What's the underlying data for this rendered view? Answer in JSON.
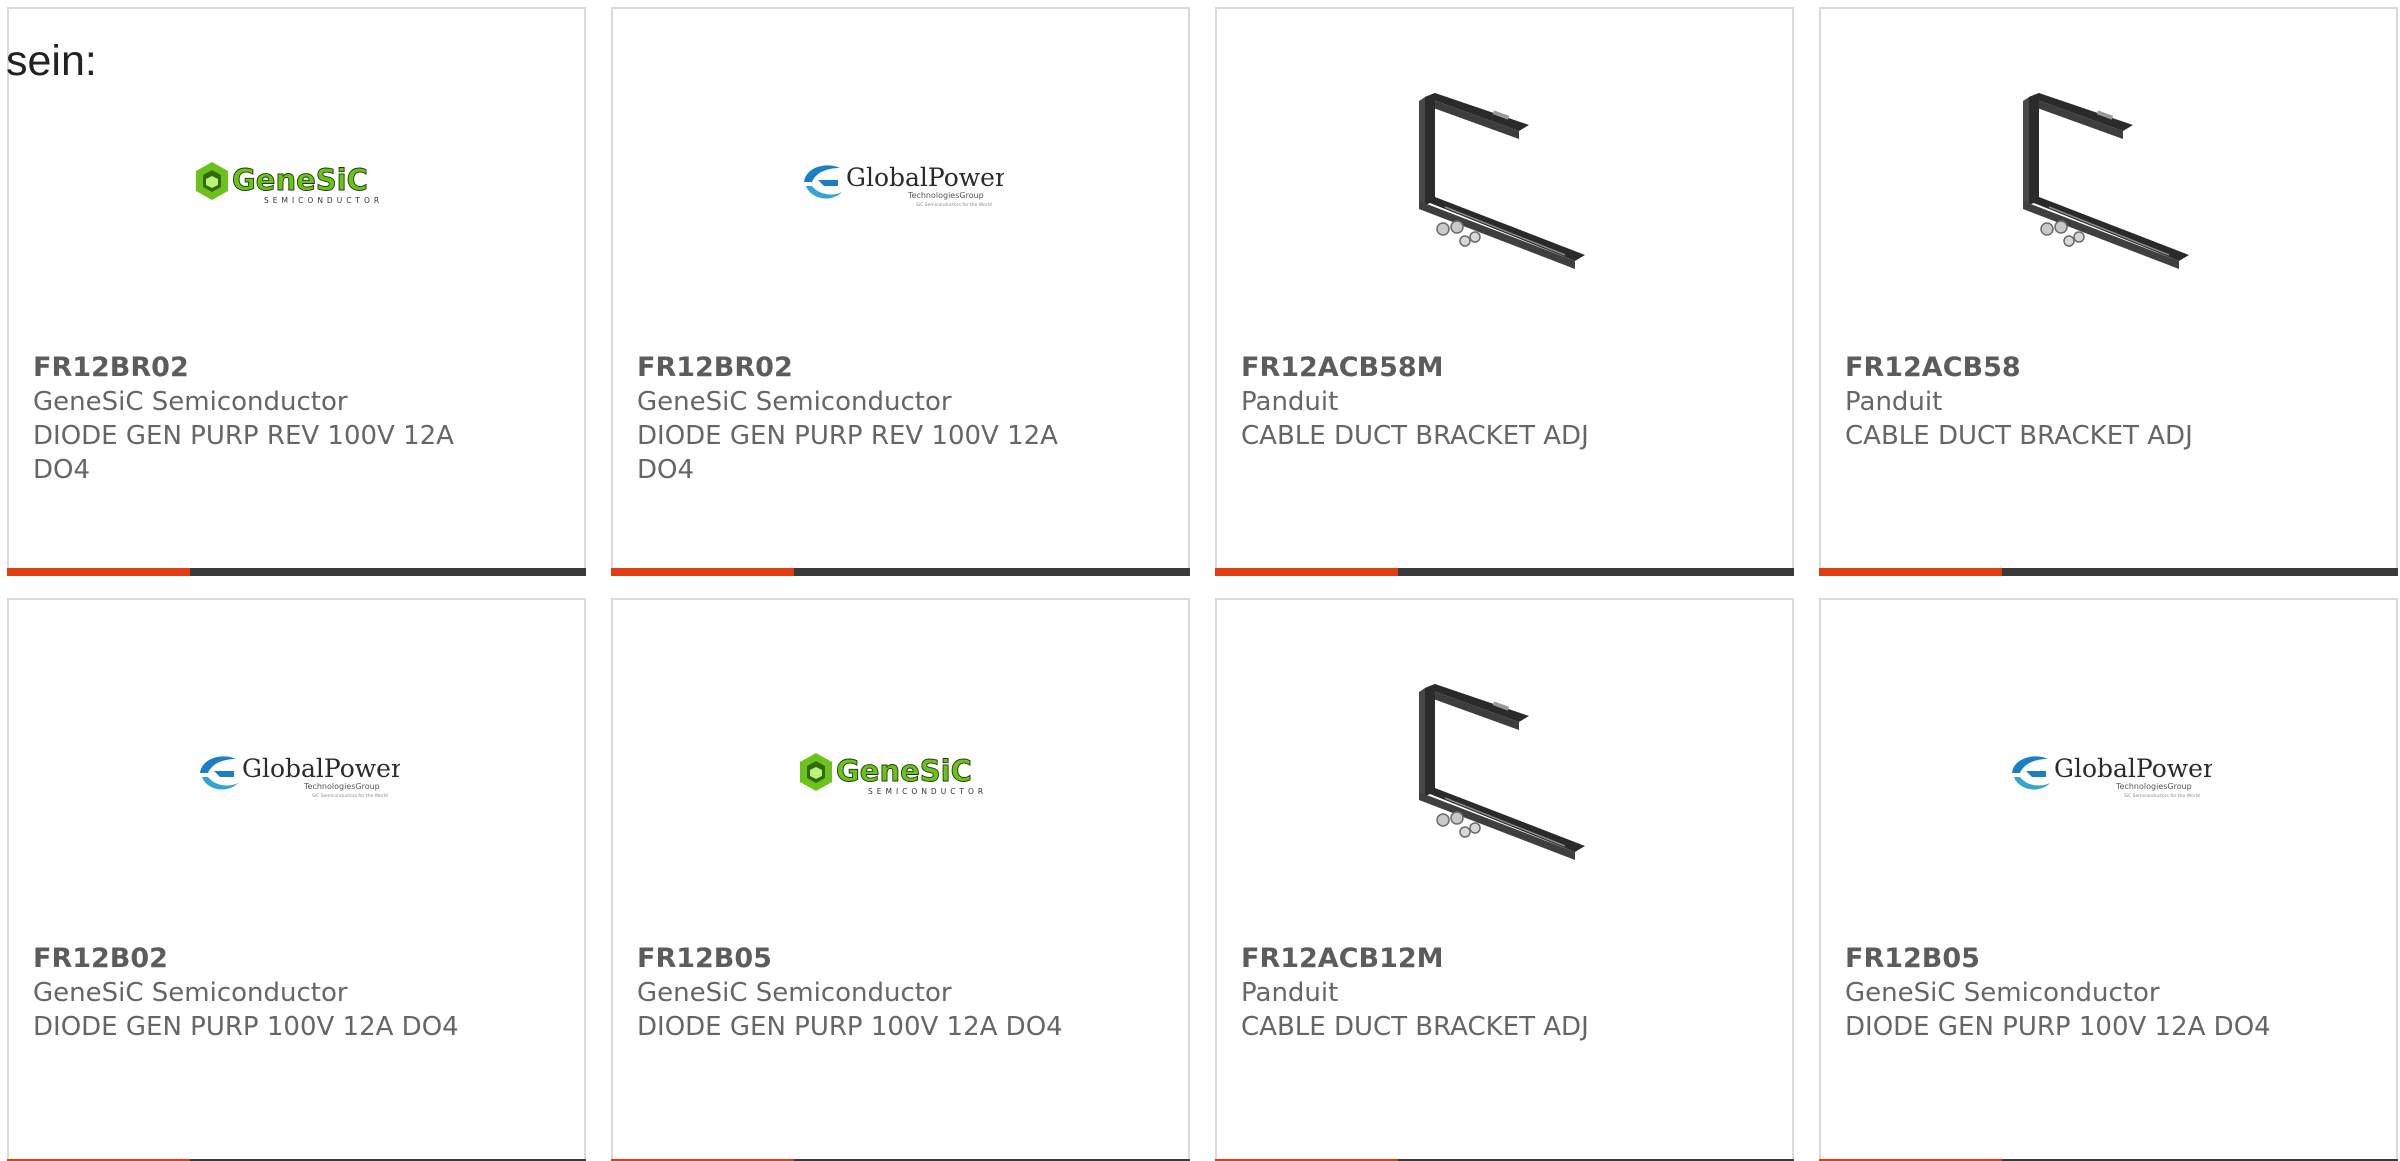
{
  "intro_text": "sein:",
  "colors": {
    "accent": "#e03c12",
    "bar": "#3a3a3a",
    "border": "#dadada",
    "genesic_green": "#6cc21c",
    "globalpower_blue": "#1a7fc4"
  },
  "products": [
    {
      "part_number": "FR12BR02",
      "manufacturer": "GeneSiC Semiconductor",
      "description": "DIODE GEN PURP REV 100V 12A DO4",
      "image": "genesic-logo"
    },
    {
      "part_number": "FR12BR02",
      "manufacturer": "GeneSiC Semiconductor",
      "description": "DIODE GEN PURP REV 100V 12A DO4",
      "image": "globalpower-logo"
    },
    {
      "part_number": "FR12ACB58M",
      "manufacturer": "Panduit",
      "description": "CABLE DUCT BRACKET ADJ",
      "image": "bracket-photo"
    },
    {
      "part_number": "FR12ACB58",
      "manufacturer": "Panduit",
      "description": "CABLE DUCT BRACKET ADJ",
      "image": "bracket-photo"
    },
    {
      "part_number": "FR12B02",
      "manufacturer": "GeneSiC Semiconductor",
      "description": "DIODE GEN PURP 100V 12A DO4",
      "image": "globalpower-logo"
    },
    {
      "part_number": "FR12B05",
      "manufacturer": "GeneSiC Semiconductor",
      "description": "DIODE GEN PURP 100V 12A DO4",
      "image": "genesic-logo"
    },
    {
      "part_number": "FR12ACB12M",
      "manufacturer": "Panduit",
      "description": "CABLE DUCT BRACKET ADJ",
      "image": "bracket-photo"
    },
    {
      "part_number": "FR12B05",
      "manufacturer": "GeneSiC Semiconductor",
      "description": "DIODE GEN PURP 100V 12A DO4",
      "image": "globalpower-logo"
    }
  ],
  "logos": {
    "genesic": {
      "wordmark": "GeneSiC",
      "tagline": "SEMICONDUCTOR"
    },
    "globalpower": {
      "wordmark": "GlobalPower",
      "tagline": "TechnologiesGroup",
      "subline": "SiC Semiconductors for the World"
    }
  }
}
